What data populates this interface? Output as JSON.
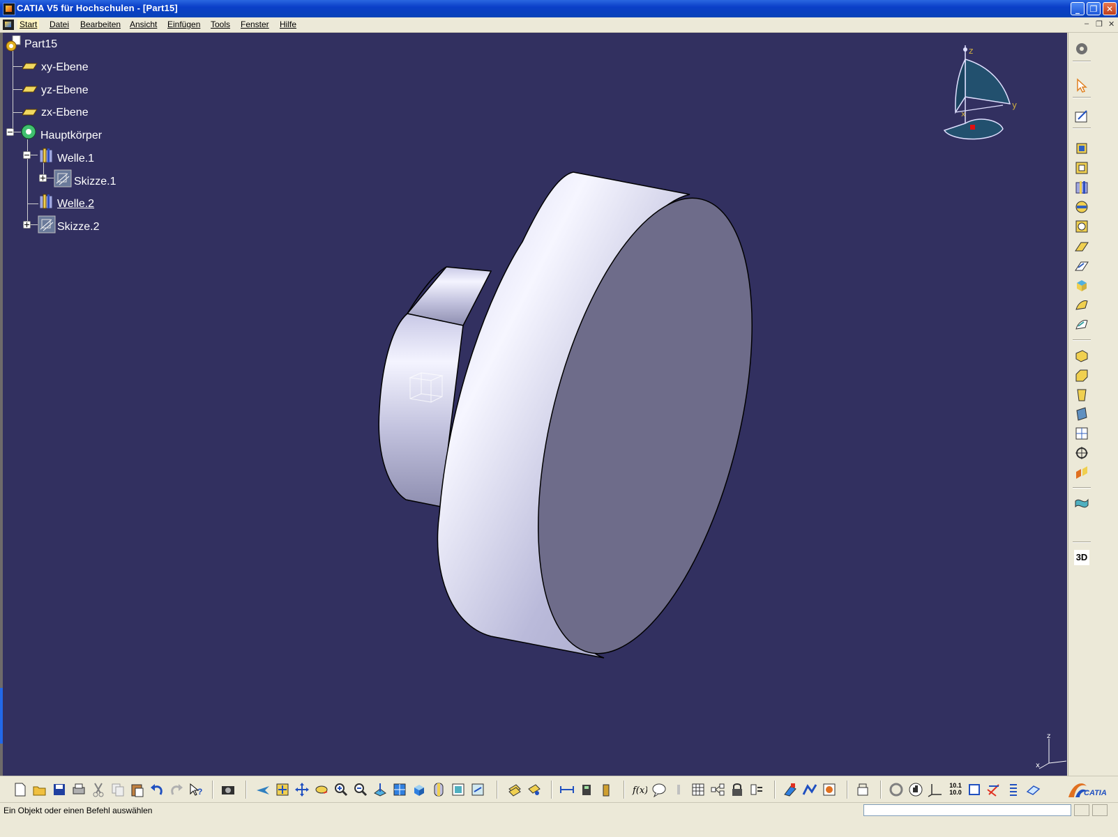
{
  "window": {
    "title": "CATIA V5 für Hochschulen - [Part15]",
    "buttons": {
      "minimize": "_",
      "maximize": "❐",
      "close": "✕"
    }
  },
  "menu": {
    "items": [
      "Start",
      "Datei",
      "Bearbeiten",
      "Ansicht",
      "Einfügen",
      "Tools",
      "Fenster",
      "Hilfe"
    ],
    "active": "Start",
    "mdi_buttons": {
      "minimize": "–",
      "restore": "❐",
      "close": "✕"
    }
  },
  "tree": {
    "root": "Part15",
    "planes": [
      "xy-Ebene",
      "yz-Ebene",
      "zx-Ebene"
    ],
    "body": "Hauptkörper",
    "feature1": "Welle.1",
    "sketch1": "Skizze.1",
    "feature2": "Welle.2",
    "sketch2": "Skizze.2"
  },
  "compass": {
    "z": "z",
    "y": "y",
    "x": "x"
  },
  "axis_triad": {
    "z": "z",
    "x": "x"
  },
  "right_toolbar": {
    "label_3d": "3D",
    "icons": [
      "settings-icon",
      "select-arrow-icon",
      "sketcher-icon",
      "pad-icon",
      "pocket-icon",
      "shaft-icon",
      "groove-icon",
      "hole-icon",
      "rib-icon",
      "slot-icon",
      "stiffener-icon",
      "multi-section-icon",
      "removed-multi-section-icon",
      "fillet-icon",
      "chamfer-icon",
      "draft-icon",
      "shell-icon",
      "thickness-icon",
      "thread-icon",
      "mirror-icon",
      "pattern-icon",
      "surface-icon",
      "3d-view-icon"
    ]
  },
  "bottom_toolbar": {
    "catia_brand": "CATIA",
    "scale_label_top": "10.1",
    "scale_label_bottom": "10.0"
  },
  "status": {
    "message": "Ein Objekt oder einen Befehl auswählen"
  },
  "colors": {
    "viewport_bg": "#323060",
    "part_face": "#6e6c8a",
    "part_side_light": "#d8d8f0",
    "compass_fill": "#22506e",
    "title_blue": "#0a3fc8"
  }
}
